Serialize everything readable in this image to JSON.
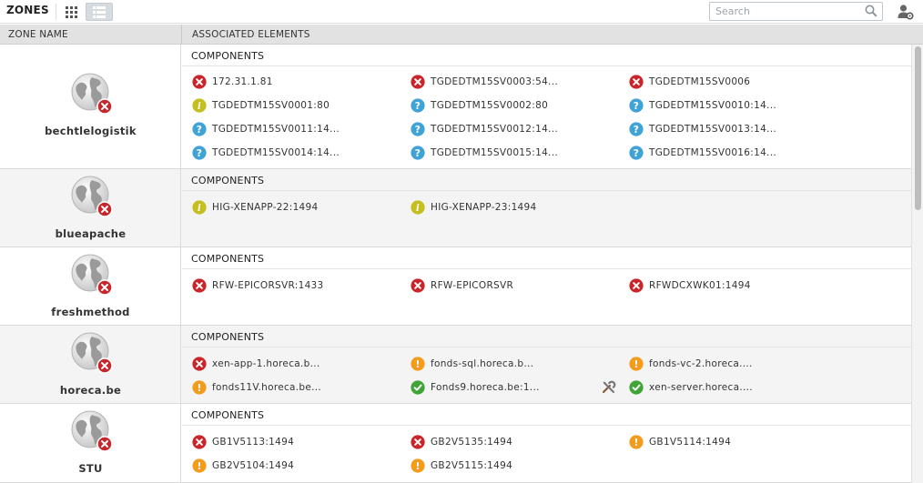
{
  "header": {
    "title": "ZONES",
    "search_placeholder": "Search"
  },
  "columns": {
    "zone_name": "ZONE NAME",
    "associated": "ASSOCIATED ELEMENTS"
  },
  "colors": {
    "error": "#c9262b",
    "info": "#c6be1c",
    "unknown": "#3fa3d8",
    "warning": "#f29b1d",
    "ok": "#3fa336"
  },
  "zones": [
    {
      "name": "bechtlelogistik",
      "section": "COMPONENTS",
      "items": [
        {
          "label": "172.31.1.81",
          "status": "error"
        },
        {
          "label": "TGDEDTM15SV0003:54...",
          "status": "error"
        },
        {
          "label": "TGDEDTM15SV0006",
          "status": "error"
        },
        {
          "label": "TGDEDTM15SV0001:80",
          "status": "info"
        },
        {
          "label": "TGDEDTM15SV0002:80",
          "status": "unknown"
        },
        {
          "label": "TGDEDTM15SV0010:14...",
          "status": "unknown"
        },
        {
          "label": "TGDEDTM15SV0011:14...",
          "status": "unknown"
        },
        {
          "label": "TGDEDTM15SV0012:14...",
          "status": "unknown"
        },
        {
          "label": "TGDEDTM15SV0013:14...",
          "status": "unknown"
        },
        {
          "label": "TGDEDTM15SV0014:14...",
          "status": "unknown"
        },
        {
          "label": "TGDEDTM15SV0015:14...",
          "status": "unknown"
        },
        {
          "label": "TGDEDTM15SV0016:14...",
          "status": "unknown"
        }
      ]
    },
    {
      "name": "blueapache",
      "section": "COMPONENTS",
      "items": [
        {
          "label": "HIG-XENAPP-22:1494",
          "status": "info"
        },
        {
          "label": "HIG-XENAPP-23:1494",
          "status": "info"
        }
      ]
    },
    {
      "name": "freshmethod",
      "section": "COMPONENTS",
      "items": [
        {
          "label": "RFW-EPICORSVR:1433",
          "status": "error"
        },
        {
          "label": "RFW-EPICORSVR",
          "status": "error"
        },
        {
          "label": "RFWDCXWK01:1494",
          "status": "error"
        }
      ]
    },
    {
      "name": "horeca.be",
      "section": "COMPONENTS",
      "items": [
        {
          "label": "xen-app-1.horeca.b...",
          "status": "error"
        },
        {
          "label": "fonds-sql.horeca.b...",
          "status": "warning"
        },
        {
          "label": "fonds-vc-2.horeca....",
          "status": "warning"
        },
        {
          "label": "fonds11V.horeca.be...",
          "status": "warning"
        },
        {
          "label": "Fonds9.horeca.be:1...",
          "status": "ok"
        },
        {
          "label": "xen-server.horeca....",
          "status": "ok",
          "maintenance": true
        }
      ]
    },
    {
      "name": "STU",
      "section": "COMPONENTS",
      "items": [
        {
          "label": "GB1V5113:1494",
          "status": "error"
        },
        {
          "label": "GB2V5135:1494",
          "status": "error"
        },
        {
          "label": "GB1V5114:1494",
          "status": "warning"
        },
        {
          "label": "GB2V5104:1494",
          "status": "warning"
        },
        {
          "label": "GB2V5115:1494",
          "status": "warning"
        }
      ]
    }
  ]
}
